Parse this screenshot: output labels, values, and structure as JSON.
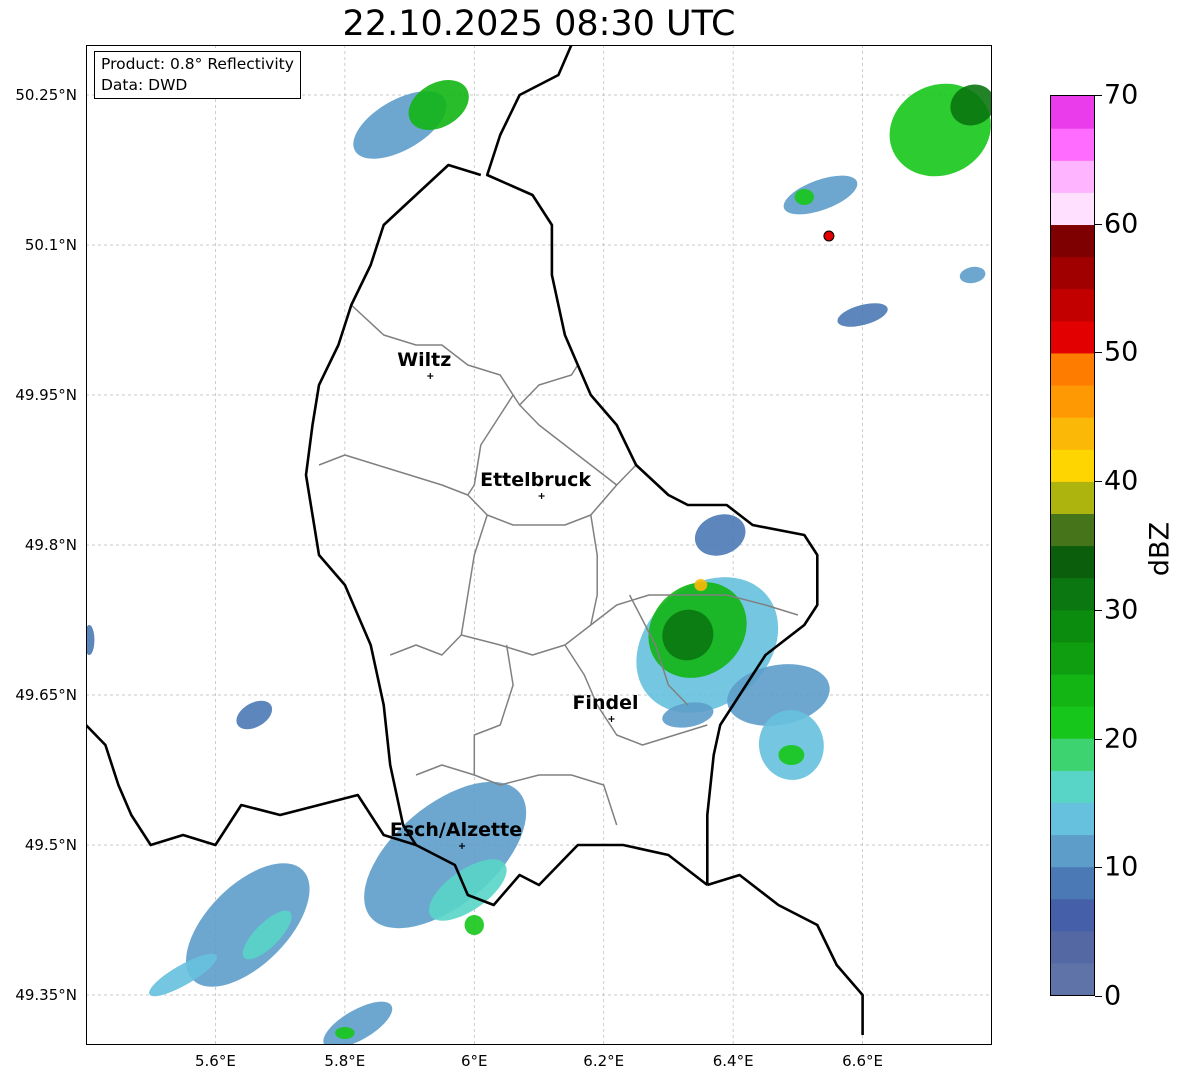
{
  "title": "22.10.2025 08:30 UTC",
  "info": {
    "product": "Product: 0.8° Reflectivity",
    "data": "Data: DWD"
  },
  "colorbar": {
    "label": "dBZ",
    "ticks": [
      "0",
      "10",
      "20",
      "30",
      "40",
      "50",
      "60",
      "70"
    ],
    "colors": [
      "#5f73a8",
      "#5468a3",
      "#4560a8",
      "#4a79b5",
      "#5d9dca",
      "#66c1de",
      "#58d5c6",
      "#3dd370",
      "#16c61a",
      "#12b514",
      "#0f9e10",
      "#0c8c0e",
      "#0a7710",
      "#0a5e0c",
      "#46741a",
      "#aeb40e",
      "#fed500",
      "#fcb806",
      "#fe9904",
      "#fe7c00",
      "#e20000",
      "#c20000",
      "#a00000",
      "#7f0000",
      "#ffe1ff",
      "#ffb4ff",
      "#ff6cff",
      "#eb3cec"
    ],
    "range": [
      0,
      70
    ]
  },
  "axes": {
    "lat_labels": [
      "50.25°N",
      "50.1°N",
      "49.95°N",
      "49.8°N",
      "49.65°N",
      "49.5°N",
      "49.35°N"
    ],
    "lon_labels": [
      "5.6°E",
      "5.8°E",
      "6°E",
      "6.2°E",
      "6.4°E",
      "6.6°E"
    ]
  },
  "map_data": {
    "lon_range": [
      5.4,
      6.8
    ],
    "lat_range": [
      49.3,
      50.3
    ],
    "grid_lon": [
      5.6,
      5.8,
      6.0,
      6.2,
      6.4,
      6.6
    ],
    "grid_lat": [
      50.25,
      50.1,
      49.95,
      49.8,
      49.65,
      49.5,
      49.35
    ],
    "radar_site": {
      "lon": 6.548,
      "lat": 50.109
    },
    "cities": [
      {
        "name": "Wiltz",
        "lon": 5.932,
        "lat": 49.969
      },
      {
        "name": "Ettelbruck",
        "lon": 6.104,
        "lat": 49.849
      },
      {
        "name": "Findel",
        "lon": 6.212,
        "lat": 49.626
      },
      {
        "name": "Esch/Alzette",
        "lon": 5.981,
        "lat": 49.499
      }
    ],
    "country_borders": [
      [
        [
          6.15,
          50.3
        ],
        [
          6.13,
          50.27
        ],
        [
          6.07,
          50.25
        ],
        [
          6.04,
          50.21
        ],
        [
          6.02,
          50.17
        ],
        [
          6.09,
          50.15
        ],
        [
          6.12,
          50.12
        ],
        [
          6.12,
          50.07
        ],
        [
          6.13,
          50.04
        ],
        [
          6.14,
          50.01
        ],
        [
          6.16,
          49.98
        ],
        [
          6.18,
          49.95
        ],
        [
          6.22,
          49.92
        ],
        [
          6.25,
          49.88
        ],
        [
          6.3,
          49.85
        ],
        [
          6.33,
          49.84
        ],
        [
          6.39,
          49.84
        ],
        [
          6.43,
          49.82
        ],
        [
          6.51,
          49.81
        ],
        [
          6.53,
          49.79
        ],
        [
          6.53,
          49.74
        ],
        [
          6.51,
          49.72
        ],
        [
          6.45,
          49.69
        ],
        [
          6.43,
          49.67
        ],
        [
          6.38,
          49.62
        ],
        [
          6.37,
          49.59
        ],
        [
          6.36,
          49.53
        ],
        [
          6.36,
          49.46
        ]
      ],
      [
        [
          6.36,
          49.46
        ],
        [
          6.41,
          49.47
        ],
        [
          6.47,
          49.44
        ],
        [
          6.53,
          49.42
        ],
        [
          6.56,
          49.38
        ],
        [
          6.6,
          49.35
        ],
        [
          6.6,
          49.31
        ]
      ],
      [
        [
          6.36,
          49.46
        ],
        [
          6.3,
          49.49
        ],
        [
          6.23,
          49.5
        ],
        [
          6.16,
          49.5
        ],
        [
          6.1,
          49.46
        ],
        [
          6.07,
          49.47
        ],
        [
          6.03,
          49.44
        ],
        [
          5.99,
          49.45
        ],
        [
          5.97,
          49.48
        ],
        [
          5.91,
          49.5
        ],
        [
          5.86,
          49.51
        ],
        [
          5.82,
          49.55
        ],
        [
          5.76,
          49.54
        ],
        [
          5.7,
          49.53
        ],
        [
          5.64,
          49.54
        ],
        [
          5.6,
          49.5
        ],
        [
          5.55,
          49.51
        ],
        [
          5.5,
          49.5
        ],
        [
          5.47,
          49.53
        ],
        [
          5.45,
          49.56
        ],
        [
          5.43,
          49.6
        ],
        [
          5.4,
          49.62
        ]
      ],
      [
        [
          5.91,
          49.5
        ],
        [
          5.89,
          49.52
        ],
        [
          5.87,
          49.58
        ],
        [
          5.86,
          49.64
        ],
        [
          5.84,
          49.7
        ],
        [
          5.82,
          49.73
        ],
        [
          5.8,
          49.76
        ],
        [
          5.76,
          49.79
        ],
        [
          5.75,
          49.83
        ],
        [
          5.74,
          49.87
        ],
        [
          5.75,
          49.92
        ],
        [
          5.76,
          49.96
        ],
        [
          5.79,
          50.0
        ],
        [
          5.81,
          50.04
        ],
        [
          5.84,
          50.08
        ],
        [
          5.86,
          50.12
        ],
        [
          5.91,
          50.15
        ],
        [
          5.96,
          50.18
        ],
        [
          6.01,
          50.17
        ]
      ]
    ],
    "district_borders": [
      [
        [
          5.81,
          50.04
        ],
        [
          5.86,
          50.01
        ],
        [
          5.91,
          50.0
        ],
        [
          5.95,
          50.0
        ],
        [
          5.99,
          49.98
        ],
        [
          6.04,
          49.97
        ],
        [
          6.06,
          49.95
        ],
        [
          6.07,
          49.94
        ],
        [
          6.1,
          49.96
        ],
        [
          6.15,
          49.97
        ],
        [
          6.16,
          49.98
        ]
      ],
      [
        [
          5.76,
          49.88
        ],
        [
          5.8,
          49.89
        ],
        [
          5.85,
          49.88
        ],
        [
          5.9,
          49.87
        ],
        [
          5.95,
          49.86
        ],
        [
          5.99,
          49.85
        ],
        [
          6.02,
          49.83
        ],
        [
          6.06,
          49.82
        ],
        [
          6.1,
          49.82
        ],
        [
          6.14,
          49.82
        ],
        [
          6.18,
          49.83
        ],
        [
          6.22,
          49.86
        ],
        [
          6.25,
          49.88
        ]
      ],
      [
        [
          6.06,
          49.95
        ],
        [
          6.04,
          49.93
        ],
        [
          6.01,
          49.9
        ],
        [
          6.0,
          49.86
        ],
        [
          5.99,
          49.85
        ]
      ],
      [
        [
          6.07,
          49.94
        ],
        [
          6.1,
          49.92
        ],
        [
          6.14,
          49.9
        ],
        [
          6.18,
          49.88
        ],
        [
          6.22,
          49.86
        ]
      ],
      [
        [
          6.02,
          49.83
        ],
        [
          6.0,
          49.79
        ],
        [
          5.99,
          49.75
        ],
        [
          5.98,
          49.71
        ],
        [
          5.95,
          49.69
        ],
        [
          5.91,
          49.7
        ],
        [
          5.87,
          49.69
        ]
      ],
      [
        [
          5.98,
          49.71
        ],
        [
          6.04,
          49.7
        ],
        [
          6.09,
          49.69
        ],
        [
          6.14,
          49.7
        ],
        [
          6.18,
          49.72
        ],
        [
          6.22,
          49.74
        ],
        [
          6.27,
          49.75
        ],
        [
          6.33,
          49.75
        ],
        [
          6.39,
          49.75
        ],
        [
          6.45,
          49.74
        ],
        [
          6.5,
          49.73
        ]
      ],
      [
        [
          6.18,
          49.83
        ],
        [
          6.19,
          49.79
        ],
        [
          6.19,
          49.75
        ],
        [
          6.18,
          49.72
        ]
      ],
      [
        [
          6.05,
          49.7
        ],
        [
          6.06,
          49.66
        ],
        [
          6.04,
          49.62
        ],
        [
          6.0,
          49.61
        ],
        [
          6.0,
          49.57
        ],
        [
          6.04,
          49.56
        ],
        [
          6.1,
          49.57
        ],
        [
          6.15,
          49.57
        ],
        [
          6.2,
          49.56
        ],
        [
          6.22,
          49.52
        ]
      ],
      [
        [
          6.14,
          49.7
        ],
        [
          6.17,
          49.67
        ],
        [
          6.19,
          49.64
        ],
        [
          6.22,
          49.61
        ],
        [
          6.26,
          49.6
        ],
        [
          6.31,
          49.61
        ],
        [
          6.36,
          49.62
        ]
      ],
      [
        [
          5.91,
          49.57
        ],
        [
          5.95,
          49.58
        ],
        [
          6.0,
          49.57
        ]
      ],
      [
        [
          6.24,
          49.75
        ],
        [
          6.28,
          49.7
        ],
        [
          6.3,
          49.66
        ],
        [
          6.33,
          49.64
        ]
      ]
    ],
    "echoes": [
      {
        "lon": 5.885,
        "lat": 50.22,
        "rlon": 0.08,
        "rlat": 0.025,
        "rot": -30,
        "dbz": 12
      },
      {
        "lon": 5.945,
        "lat": 50.24,
        "rlon": 0.05,
        "rlat": 0.022,
        "rot": -30,
        "dbz": 24
      },
      {
        "lon": 6.535,
        "lat": 50.15,
        "rlon": 0.06,
        "rlat": 0.015,
        "rot": -20,
        "dbz": 10
      },
      {
        "lon": 6.51,
        "lat": 50.148,
        "rlon": 0.015,
        "rlat": 0.008,
        "rot": 0,
        "dbz": 22
      },
      {
        "lon": 6.72,
        "lat": 50.215,
        "rlon": 0.08,
        "rlat": 0.045,
        "rot": -25,
        "dbz": 22
      },
      {
        "lon": 6.77,
        "lat": 50.24,
        "rlon": 0.035,
        "rlat": 0.02,
        "rot": -25,
        "dbz": 30
      },
      {
        "lon": 6.6,
        "lat": 50.03,
        "rlon": 0.04,
        "rlat": 0.01,
        "rot": -15,
        "dbz": 8
      },
      {
        "lon": 6.77,
        "lat": 50.07,
        "rlon": 0.02,
        "rlat": 0.008,
        "rot": -10,
        "dbz": 12
      },
      {
        "lon": 6.38,
        "lat": 49.81,
        "rlon": 0.04,
        "rlat": 0.02,
        "rot": -20,
        "dbz": 8
      },
      {
        "lon": 6.36,
        "lat": 49.7,
        "rlon": 0.12,
        "rlat": 0.06,
        "rot": -40,
        "dbz": 14
      },
      {
        "lon": 6.345,
        "lat": 49.715,
        "rlon": 0.08,
        "rlat": 0.045,
        "rot": -40,
        "dbz": 24
      },
      {
        "lon": 6.33,
        "lat": 49.71,
        "rlon": 0.04,
        "rlat": 0.025,
        "rot": -40,
        "dbz": 30
      },
      {
        "lon": 6.35,
        "lat": 49.76,
        "rlon": 0.01,
        "rlat": 0.006,
        "rot": 0,
        "dbz": 44
      },
      {
        "lon": 6.47,
        "lat": 49.65,
        "rlon": 0.08,
        "rlat": 0.03,
        "rot": -10,
        "dbz": 10
      },
      {
        "lon": 6.49,
        "lat": 49.6,
        "rlon": 0.05,
        "rlat": 0.035,
        "rot": -10,
        "dbz": 14
      },
      {
        "lon": 6.49,
        "lat": 49.59,
        "rlon": 0.02,
        "rlat": 0.01,
        "rot": 0,
        "dbz": 20
      },
      {
        "lon": 6.33,
        "lat": 49.63,
        "rlon": 0.04,
        "rlat": 0.012,
        "rot": -10,
        "dbz": 10
      },
      {
        "lon": 5.66,
        "lat": 49.63,
        "rlon": 0.03,
        "rlat": 0.012,
        "rot": -30,
        "dbz": 8
      },
      {
        "lon": 5.405,
        "lat": 49.705,
        "rlon": 0.008,
        "rlat": 0.015,
        "rot": 0,
        "dbz": 8
      },
      {
        "lon": 5.955,
        "lat": 49.49,
        "rlon": 0.15,
        "rlat": 0.05,
        "rot": -40,
        "dbz": 10
      },
      {
        "lon": 5.99,
        "lat": 49.455,
        "rlon": 0.07,
        "rlat": 0.02,
        "rot": -35,
        "dbz": 16
      },
      {
        "lon": 6.0,
        "lat": 49.42,
        "rlon": 0.015,
        "rlat": 0.01,
        "rot": 0,
        "dbz": 22
      },
      {
        "lon": 5.65,
        "lat": 49.42,
        "rlon": 0.12,
        "rlat": 0.04,
        "rot": -45,
        "dbz": 10
      },
      {
        "lon": 5.68,
        "lat": 49.41,
        "rlon": 0.05,
        "rlat": 0.012,
        "rot": -45,
        "dbz": 16
      },
      {
        "lon": 5.55,
        "lat": 49.37,
        "rlon": 0.06,
        "rlat": 0.01,
        "rot": -30,
        "dbz": 14
      },
      {
        "lon": 5.82,
        "lat": 49.32,
        "rlon": 0.06,
        "rlat": 0.015,
        "rot": -30,
        "dbz": 12
      },
      {
        "lon": 5.8,
        "lat": 49.312,
        "rlon": 0.015,
        "rlat": 0.006,
        "rot": 0,
        "dbz": 22
      }
    ]
  }
}
